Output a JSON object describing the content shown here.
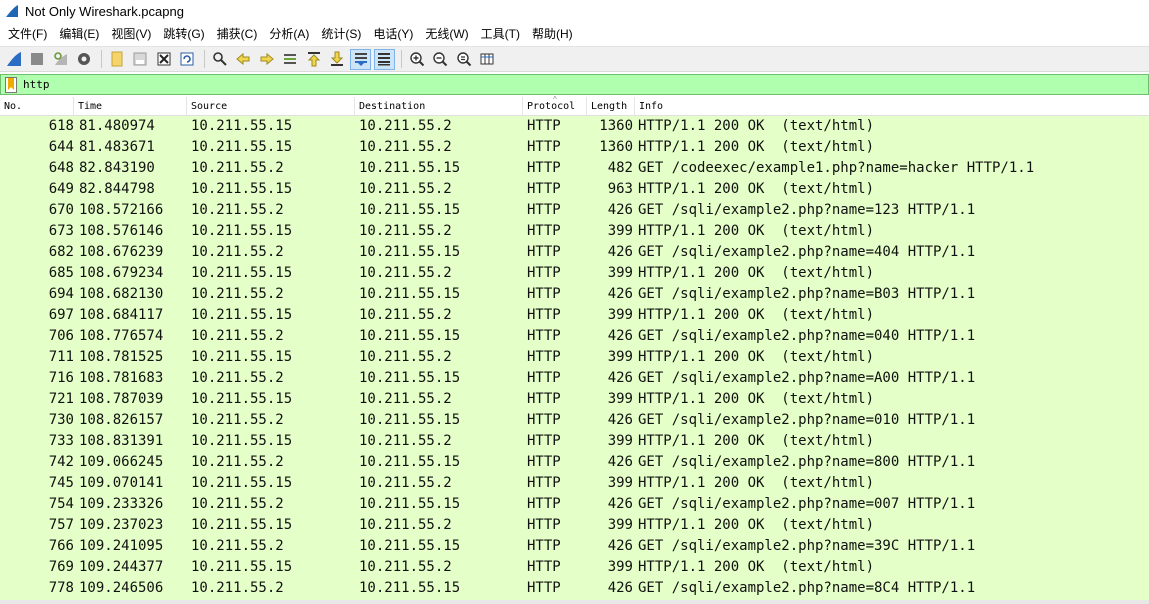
{
  "window": {
    "title": "Not Only Wireshark.pcapng"
  },
  "menu": [
    "文件(F)",
    "编辑(E)",
    "视图(V)",
    "跳转(G)",
    "捕获(C)",
    "分析(A)",
    "统计(S)",
    "电话(Y)",
    "无线(W)",
    "工具(T)",
    "帮助(H)"
  ],
  "toolbar": {
    "icons": [
      "shark-fin-start-capture-icon",
      "stop-capture-icon",
      "restart-capture-icon",
      "capture-options-icon",
      "open-file-icon",
      "save-file-icon",
      "close-file-icon",
      "reload-file-icon",
      "find-packet-icon",
      "go-back-icon",
      "go-forward-icon",
      "go-to-packet-icon",
      "go-first-packet-icon",
      "go-last-packet-icon",
      "auto-scroll-icon",
      "colorize-icon",
      "zoom-in-icon",
      "zoom-out-icon",
      "normal-size-icon",
      "resize-columns-icon"
    ]
  },
  "filter": {
    "value": "http"
  },
  "columns": [
    "No.",
    "Time",
    "Source",
    "Destination",
    "Protocol",
    "Length",
    "Info"
  ],
  "colors": {
    "row_bg": "#e4ffc7",
    "filter_bg": "#afffaf"
  },
  "packets": [
    {
      "no": "618",
      "time": "81.480974",
      "src": "10.211.55.15",
      "dst": "10.211.55.2",
      "proto": "HTTP",
      "len": "1360",
      "info": "HTTP/1.1 200 OK  (text/html)"
    },
    {
      "no": "644",
      "time": "81.483671",
      "src": "10.211.55.15",
      "dst": "10.211.55.2",
      "proto": "HTTP",
      "len": "1360",
      "info": "HTTP/1.1 200 OK  (text/html)"
    },
    {
      "no": "648",
      "time": "82.843190",
      "src": "10.211.55.2",
      "dst": "10.211.55.15",
      "proto": "HTTP",
      "len": "482",
      "info": "GET /codeexec/example1.php?name=hacker HTTP/1.1"
    },
    {
      "no": "649",
      "time": "82.844798",
      "src": "10.211.55.15",
      "dst": "10.211.55.2",
      "proto": "HTTP",
      "len": "963",
      "info": "HTTP/1.1 200 OK  (text/html)"
    },
    {
      "no": "670",
      "time": "108.572166",
      "src": "10.211.55.2",
      "dst": "10.211.55.15",
      "proto": "HTTP",
      "len": "426",
      "info": "GET /sqli/example2.php?name=123 HTTP/1.1"
    },
    {
      "no": "673",
      "time": "108.576146",
      "src": "10.211.55.15",
      "dst": "10.211.55.2",
      "proto": "HTTP",
      "len": "399",
      "info": "HTTP/1.1 200 OK  (text/html)"
    },
    {
      "no": "682",
      "time": "108.676239",
      "src": "10.211.55.2",
      "dst": "10.211.55.15",
      "proto": "HTTP",
      "len": "426",
      "info": "GET /sqli/example2.php?name=404 HTTP/1.1"
    },
    {
      "no": "685",
      "time": "108.679234",
      "src": "10.211.55.15",
      "dst": "10.211.55.2",
      "proto": "HTTP",
      "len": "399",
      "info": "HTTP/1.1 200 OK  (text/html)"
    },
    {
      "no": "694",
      "time": "108.682130",
      "src": "10.211.55.2",
      "dst": "10.211.55.15",
      "proto": "HTTP",
      "len": "426",
      "info": "GET /sqli/example2.php?name=B03 HTTP/1.1"
    },
    {
      "no": "697",
      "time": "108.684117",
      "src": "10.211.55.15",
      "dst": "10.211.55.2",
      "proto": "HTTP",
      "len": "399",
      "info": "HTTP/1.1 200 OK  (text/html)"
    },
    {
      "no": "706",
      "time": "108.776574",
      "src": "10.211.55.2",
      "dst": "10.211.55.15",
      "proto": "HTTP",
      "len": "426",
      "info": "GET /sqli/example2.php?name=040 HTTP/1.1"
    },
    {
      "no": "711",
      "time": "108.781525",
      "src": "10.211.55.15",
      "dst": "10.211.55.2",
      "proto": "HTTP",
      "len": "399",
      "info": "HTTP/1.1 200 OK  (text/html)"
    },
    {
      "no": "716",
      "time": "108.781683",
      "src": "10.211.55.2",
      "dst": "10.211.55.15",
      "proto": "HTTP",
      "len": "426",
      "info": "GET /sqli/example2.php?name=A00 HTTP/1.1"
    },
    {
      "no": "721",
      "time": "108.787039",
      "src": "10.211.55.15",
      "dst": "10.211.55.2",
      "proto": "HTTP",
      "len": "399",
      "info": "HTTP/1.1 200 OK  (text/html)"
    },
    {
      "no": "730",
      "time": "108.826157",
      "src": "10.211.55.2",
      "dst": "10.211.55.15",
      "proto": "HTTP",
      "len": "426",
      "info": "GET /sqli/example2.php?name=010 HTTP/1.1"
    },
    {
      "no": "733",
      "time": "108.831391",
      "src": "10.211.55.15",
      "dst": "10.211.55.2",
      "proto": "HTTP",
      "len": "399",
      "info": "HTTP/1.1 200 OK  (text/html)"
    },
    {
      "no": "742",
      "time": "109.066245",
      "src": "10.211.55.2",
      "dst": "10.211.55.15",
      "proto": "HTTP",
      "len": "426",
      "info": "GET /sqli/example2.php?name=800 HTTP/1.1"
    },
    {
      "no": "745",
      "time": "109.070141",
      "src": "10.211.55.15",
      "dst": "10.211.55.2",
      "proto": "HTTP",
      "len": "399",
      "info": "HTTP/1.1 200 OK  (text/html)"
    },
    {
      "no": "754",
      "time": "109.233326",
      "src": "10.211.55.2",
      "dst": "10.211.55.15",
      "proto": "HTTP",
      "len": "426",
      "info": "GET /sqli/example2.php?name=007 HTTP/1.1"
    },
    {
      "no": "757",
      "time": "109.237023",
      "src": "10.211.55.15",
      "dst": "10.211.55.2",
      "proto": "HTTP",
      "len": "399",
      "info": "HTTP/1.1 200 OK  (text/html)"
    },
    {
      "no": "766",
      "time": "109.241095",
      "src": "10.211.55.2",
      "dst": "10.211.55.15",
      "proto": "HTTP",
      "len": "426",
      "info": "GET /sqli/example2.php?name=39C HTTP/1.1"
    },
    {
      "no": "769",
      "time": "109.244377",
      "src": "10.211.55.15",
      "dst": "10.211.55.2",
      "proto": "HTTP",
      "len": "399",
      "info": "HTTP/1.1 200 OK  (text/html)"
    },
    {
      "no": "778",
      "time": "109.246506",
      "src": "10.211.55.2",
      "dst": "10.211.55.15",
      "proto": "HTTP",
      "len": "426",
      "info": "GET /sqli/example2.php?name=8C4 HTTP/1.1"
    }
  ]
}
